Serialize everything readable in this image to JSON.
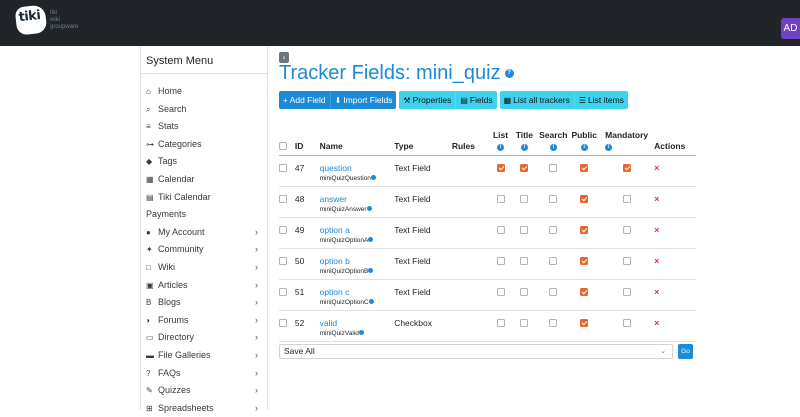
{
  "header": {
    "logo_text": "tiki",
    "logo_tagline": [
      "tiki",
      "wiki",
      "groupware"
    ],
    "user_initials": "AD"
  },
  "sidebar": {
    "title": "System Menu",
    "items": [
      {
        "icon": "home-icon",
        "glyph": "⌂",
        "label": "Home",
        "chevron": false
      },
      {
        "icon": "search-icon",
        "glyph": "⌕",
        "label": "Search",
        "chevron": false
      },
      {
        "icon": "stats-icon",
        "glyph": "≡",
        "label": "Stats",
        "chevron": false
      },
      {
        "icon": "categories-icon",
        "glyph": "⊶",
        "label": "Categories",
        "chevron": false
      },
      {
        "icon": "tags-icon",
        "glyph": "◆",
        "label": "Tags",
        "chevron": false
      },
      {
        "icon": "calendar-icon",
        "glyph": "▦",
        "label": "Calendar",
        "chevron": false
      },
      {
        "icon": "tiki-calendar-icon",
        "glyph": "▤",
        "label": "Tiki Calendar",
        "chevron": false
      },
      {
        "icon": "",
        "glyph": "",
        "label": "Payments",
        "chevron": false
      },
      {
        "icon": "user-icon",
        "glyph": "●",
        "label": "My Account",
        "chevron": true
      },
      {
        "icon": "community-icon",
        "glyph": "✦",
        "label": "Community",
        "chevron": true
      },
      {
        "icon": "wiki-icon",
        "glyph": "□",
        "label": "Wiki",
        "chevron": true
      },
      {
        "icon": "articles-icon",
        "glyph": "▣",
        "label": "Articles",
        "chevron": true
      },
      {
        "icon": "blogs-icon",
        "glyph": "B",
        "label": "Blogs",
        "chevron": true
      },
      {
        "icon": "forums-icon",
        "glyph": "◗",
        "label": "Forums",
        "chevron": true
      },
      {
        "icon": "directory-icon",
        "glyph": "▭",
        "label": "Directory",
        "chevron": true
      },
      {
        "icon": "file-galleries-icon",
        "glyph": "▬",
        "label": "File Galleries",
        "chevron": true
      },
      {
        "icon": "faqs-icon",
        "glyph": "?",
        "label": "FAQs",
        "chevron": true
      },
      {
        "icon": "quizzes-icon",
        "glyph": "✎",
        "label": "Quizzes",
        "chevron": true
      },
      {
        "icon": "spreadsheets-icon",
        "glyph": "⊞",
        "label": "Spreadsheets",
        "chevron": true
      }
    ],
    "chevron_glyph": "›"
  },
  "main": {
    "collapse_glyph": "‹",
    "title": "Tracker Fields: mini_quiz",
    "help_glyph": "?",
    "toolbar": {
      "add_field": "Add Field",
      "import_fields": "Import Fields",
      "properties": "Properties",
      "fields": "Fields",
      "list_all_trackers": "List all trackers",
      "list_items": "List items"
    },
    "columns": {
      "id": "ID",
      "name": "Name",
      "type": "Type",
      "rules": "Rules",
      "list": "List",
      "title": "Title",
      "search": "Search",
      "public": "Public",
      "mandatory": "Mandatory",
      "actions": "Actions"
    },
    "rows": [
      {
        "id": "47",
        "name": "question",
        "perm": "miniQuizQuestion",
        "type": "Text Field",
        "list": true,
        "title": true,
        "search": false,
        "public": true,
        "mandatory": true
      },
      {
        "id": "48",
        "name": "answer",
        "perm": "miniQuizAnswer",
        "type": "Text Field",
        "list": false,
        "title": false,
        "search": false,
        "public": true,
        "mandatory": false
      },
      {
        "id": "49",
        "name": "option a",
        "perm": "miniQuizOptionA",
        "type": "Text Field",
        "list": false,
        "title": false,
        "search": false,
        "public": true,
        "mandatory": false
      },
      {
        "id": "50",
        "name": "option b",
        "perm": "miniQuizOptionB",
        "type": "Text Field",
        "list": false,
        "title": false,
        "search": false,
        "public": true,
        "mandatory": false
      },
      {
        "id": "51",
        "name": "option c",
        "perm": "miniQuizOptionC",
        "type": "Text Field",
        "list": false,
        "title": false,
        "search": false,
        "public": true,
        "mandatory": false
      },
      {
        "id": "52",
        "name": "valid",
        "perm": "miniQuizValid",
        "type": "Checkbox",
        "list": false,
        "title": false,
        "search": false,
        "public": true,
        "mandatory": false
      }
    ],
    "delete_glyph": "×",
    "bulk_action": "Save All",
    "go_label": "Go",
    "select_caret": "⌄"
  },
  "colors": {
    "primary": "#1b8ad8",
    "info": "#3dd2ed",
    "checked": "#e8672c",
    "danger": "#dc3545",
    "topbar": "#21252a",
    "user_badge": "#6f42c1"
  }
}
